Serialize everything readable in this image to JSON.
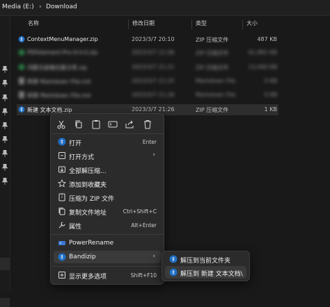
{
  "breadcrumb": {
    "drive": "Media (E:)",
    "separator": "›",
    "folder": "Download"
  },
  "columns": {
    "name": "名称",
    "date": "修改日期",
    "type": "类型",
    "size": "大小"
  },
  "files": [
    {
      "name": "ContextMenuManager.zip",
      "date": "2023/3/7 20:10",
      "type": "ZIP 压缩文件",
      "size": "487 KB"
    },
    {
      "name": "PDFelement-Pro-9.4.0.zip",
      "date": "2023/3/7 21:06",
      "type": "ZIP 压缩文件",
      "size": "61,892 KB"
    },
    {
      "name": "鸿蒙全家桶合集分享.zip",
      "date": "2023/3/7 21:21",
      "type": "ZIP 压缩文件",
      "size": "13,440 KB"
    },
    {
      "name": "新建 Markdown File.md",
      "date": "2023/3/7 21:25",
      "type": "Markdown File",
      "size": "0 KB"
    },
    {
      "name": "新建 Markdown File.md",
      "date": "2023/3/7 21:26",
      "type": "Markdown File",
      "size": "0 KB"
    },
    {
      "name": "新建 文本文档.zip",
      "date": "2023/3/7 21:26",
      "type": "ZIP 压缩文件",
      "size": "1 KB"
    }
  ],
  "quick_actions": [
    "cut-icon",
    "copy-icon",
    "paste-icon",
    "rename-icon",
    "share-icon",
    "delete-icon"
  ],
  "menu": {
    "open": {
      "label": "打开",
      "shortcut": "Enter"
    },
    "open_with": {
      "label": "打开方式",
      "arrow": "›"
    },
    "extract_all": {
      "label": "全部解压缩..."
    },
    "add_favorites": {
      "label": "添加到收藏夹"
    },
    "compress_zip": {
      "label": "压缩为 ZIP 文件"
    },
    "copy_path": {
      "label": "复制文件地址",
      "shortcut": "Ctrl+Shift+C"
    },
    "properties": {
      "label": "属性",
      "shortcut": "Alt+Enter"
    },
    "powerrename": {
      "label": "PowerRename"
    },
    "bandizip": {
      "label": "Bandizip",
      "arrow": "›"
    },
    "more_options": {
      "label": "显示更多选项",
      "shortcut": "Shift+F10"
    }
  },
  "submenu": {
    "extract_here": "解压到当前文件夹",
    "extract_to": "解压到 新建 文本文档\\"
  },
  "colors": {
    "accent": "#4aa3ff",
    "background": "#191919",
    "menu": "#2b2b2b"
  }
}
